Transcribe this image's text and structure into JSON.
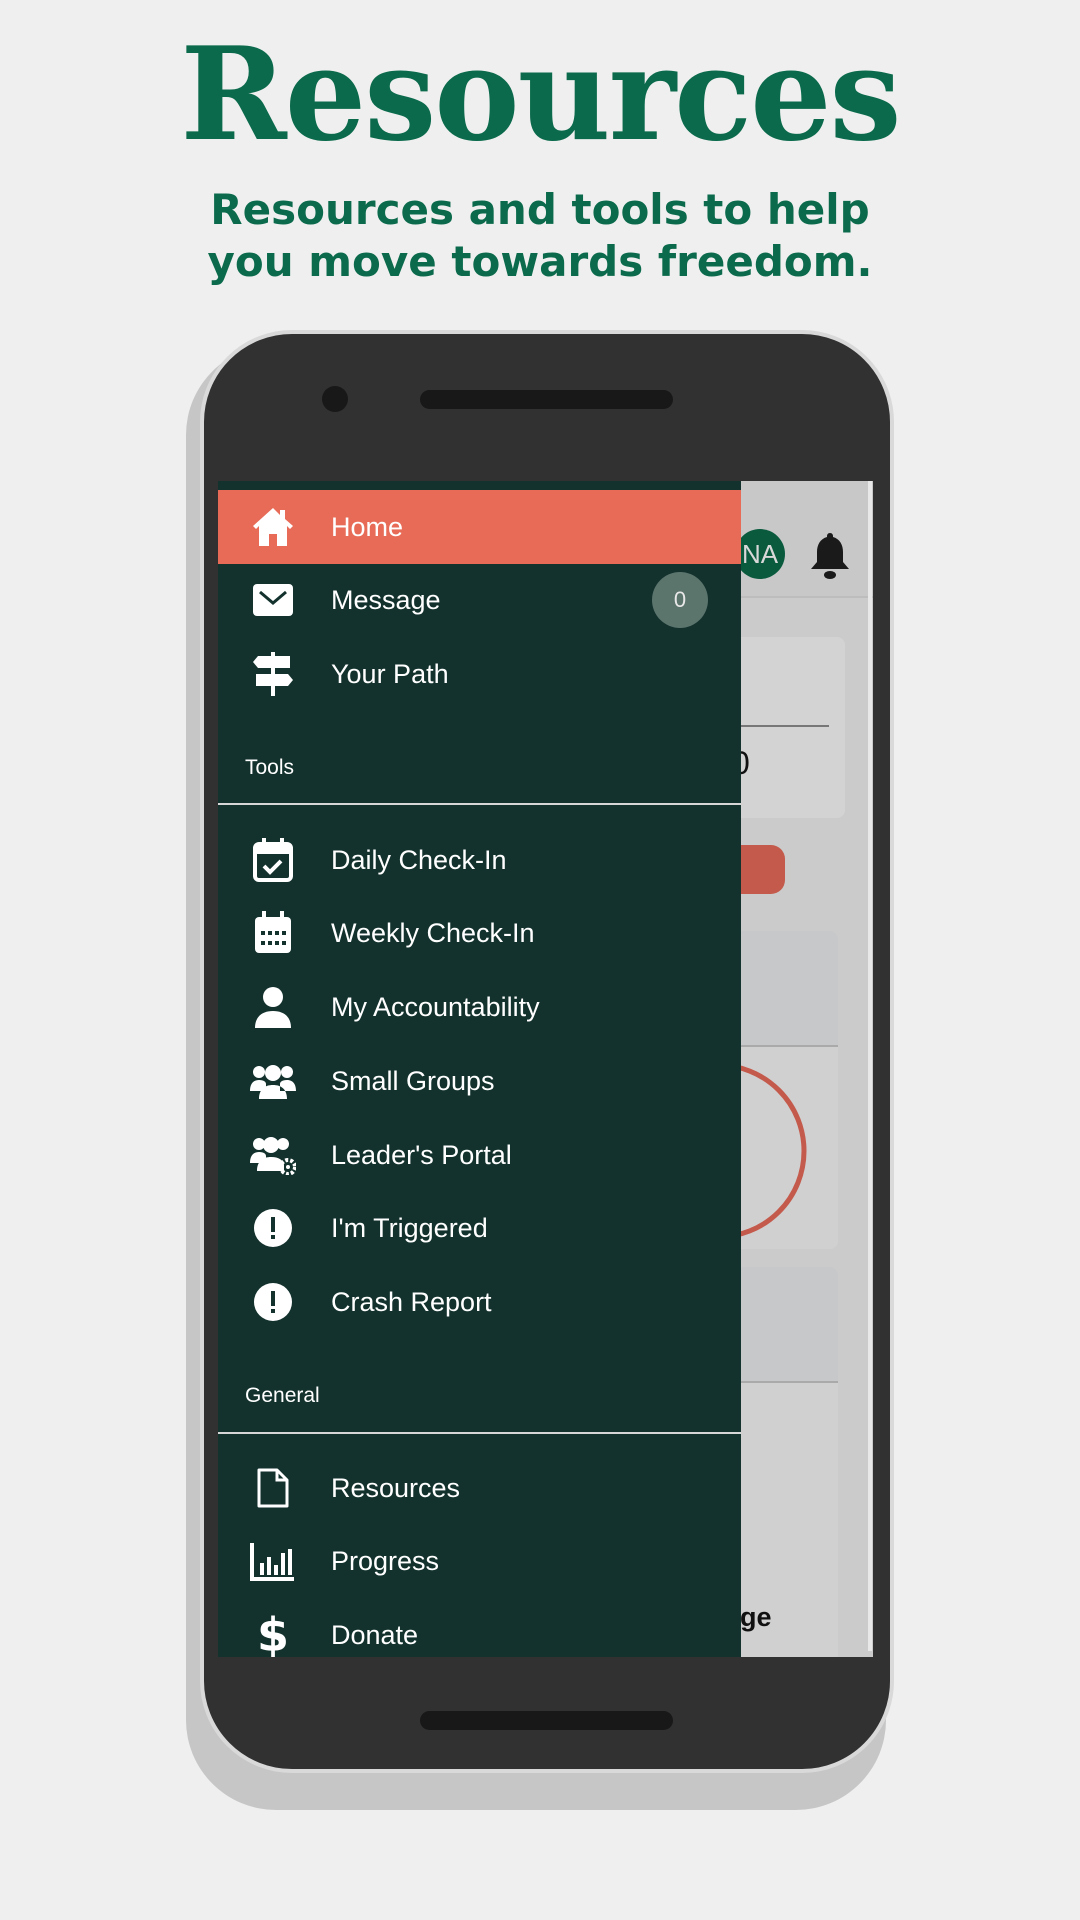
{
  "header": {
    "title": "Resources",
    "subtitle_line1": "Resources and tools to help",
    "subtitle_line2": "you move towards freedom."
  },
  "app": {
    "avatar_initials": "NA",
    "partial_text": "ge",
    "partial_digit": "0",
    "accent": "#e76b57",
    "drawer_bg": "#13322d"
  },
  "drawer": {
    "main": [
      {
        "label": "Home",
        "icon": "home-icon",
        "active": true
      },
      {
        "label": "Message",
        "icon": "envelope-icon",
        "badge": "0"
      },
      {
        "label": "Your Path",
        "icon": "signpost-icon"
      }
    ],
    "tools_label": "Tools",
    "tools": [
      {
        "label": "Daily Check-In",
        "icon": "calendar-check-icon"
      },
      {
        "label": "Weekly Check-In",
        "icon": "calendar-week-icon"
      },
      {
        "label": "My Accountability",
        "icon": "user-icon"
      },
      {
        "label": "Small Groups",
        "icon": "users-icon"
      },
      {
        "label": "Leader's Portal",
        "icon": "users-gear-icon"
      },
      {
        "label": "I'm Triggered",
        "icon": "exclamation-circle-icon"
      },
      {
        "label": "Crash Report",
        "icon": "exclamation-circle-icon"
      }
    ],
    "general_label": "General",
    "general": [
      {
        "label": "Resources",
        "icon": "file-icon"
      },
      {
        "label": "Progress",
        "icon": "bar-chart-icon"
      },
      {
        "label": "Donate",
        "icon": "dollar-icon"
      }
    ]
  }
}
